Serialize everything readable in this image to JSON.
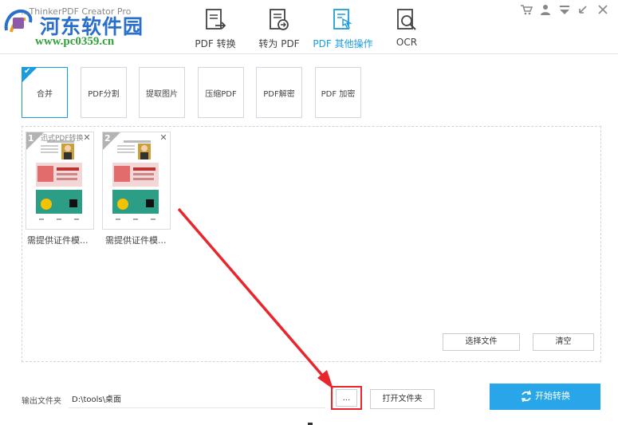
{
  "header": {
    "app_title": "...ThinkerPDF Creator Pro",
    "watermark_text": "河东软件园",
    "watermark_url": "www.pc0359.cn",
    "tabs": [
      {
        "label": "PDF 转换",
        "icon": "pdf-convert-icon",
        "active": false
      },
      {
        "label": "转为 PDF",
        "icon": "to-pdf-icon",
        "active": false
      },
      {
        "label": "PDF 其他操作",
        "icon": "pdf-tools-icon",
        "active": true
      },
      {
        "label": "OCR",
        "icon": "ocr-icon",
        "active": false
      }
    ],
    "window_controls": [
      "cart-icon",
      "user-icon",
      "menu-icon",
      "minimize-icon",
      "close-icon"
    ]
  },
  "tools": [
    {
      "label": "合并",
      "active": true
    },
    {
      "label": "PDF分割",
      "active": false
    },
    {
      "label": "提取图片",
      "active": false
    },
    {
      "label": "压缩PDF",
      "active": false
    },
    {
      "label": "PDF解密",
      "active": false
    },
    {
      "label": "PDF 加密",
      "active": false
    }
  ],
  "files": [
    {
      "index": "1",
      "name": "需提供证件模...",
      "overlay": "迅式PDF转换"
    },
    {
      "index": "2",
      "name": "需提供证件模...",
      "overlay": ""
    }
  ],
  "actions": {
    "select_file": "选择文件",
    "clear": "清空"
  },
  "output": {
    "label": "输出文件夹",
    "path": "D:\\tools\\桌面",
    "browse": "...",
    "open_folder": "打开文件夹",
    "start": "开始转换"
  },
  "colors": {
    "accent": "#1a9de0",
    "start_button": "#29a6ea",
    "highlight": "#e8262c",
    "watermark_blue": "#2a6fc9",
    "watermark_green": "#31a13a"
  }
}
